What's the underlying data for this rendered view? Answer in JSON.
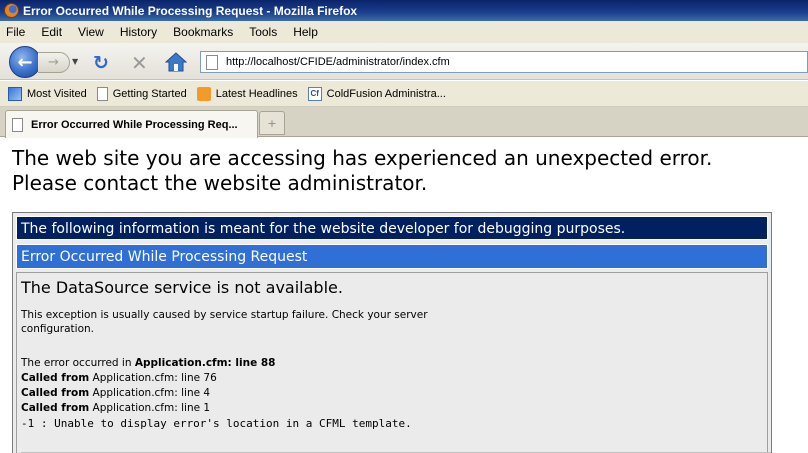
{
  "window": {
    "title": "Error Occurred While Processing Request - Mozilla Firefox"
  },
  "menu": {
    "items": [
      "File",
      "Edit",
      "View",
      "History",
      "Bookmarks",
      "Tools",
      "Help"
    ]
  },
  "navbar": {
    "url": "http://localhost/CFIDE/administrator/index.cfm"
  },
  "bookmarks": {
    "items": [
      "Most Visited",
      "Getting Started",
      "Latest Headlines",
      "ColdFusion Administra..."
    ]
  },
  "tabs": {
    "active_label": "Error Occurred While Processing Req...",
    "new_tab_symbol": "+"
  },
  "page": {
    "headline_line1": "The web site you are accessing has experienced an unexpected error.",
    "headline_line2": "Please contact the website administrator.",
    "developer_notice": "The following information is meant for the website developer for debugging purposes.",
    "error_title": "Error Occurred While Processing Request",
    "error_message": "The DataSource service is not available.",
    "cause_line1": "This exception is usually caused by service startup failure. Check your server",
    "cause_line2": "configuration.",
    "trace_prefix": "The error occurred in",
    "trace_location": "Application.cfm: line 88",
    "called_from_label": "Called from",
    "called_from": [
      "Application.cfm: line 76",
      "Application.cfm: line 4",
      "Application.cfm: line 1"
    ],
    "template_note": "-1 : Unable to display error's location in a CFML template."
  },
  "colors": {
    "developer_row_bg": "#002060",
    "error_title_bg": "#2f6fd6",
    "panel_bg": "#ebebeb"
  }
}
